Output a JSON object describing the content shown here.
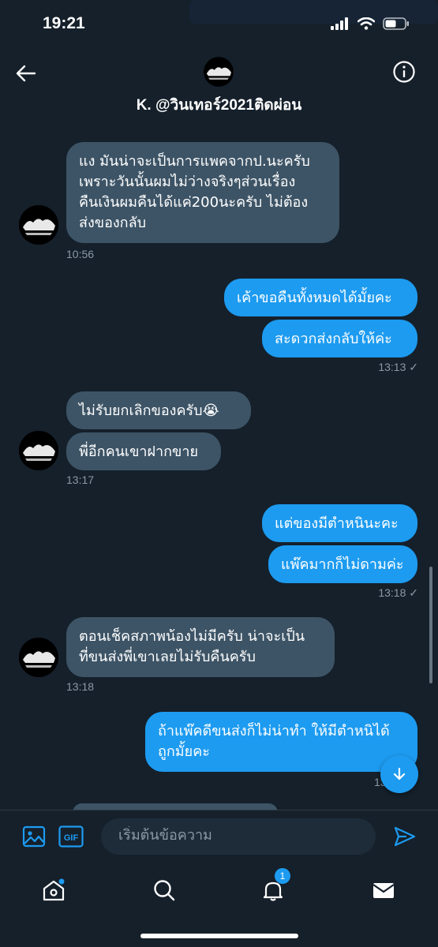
{
  "status": {
    "time": "19:21"
  },
  "header": {
    "title": "K. @วินเทอร์2021ติดผ่อน"
  },
  "messages": {
    "m1": {
      "text": "แง มันน่าจะเป็นการแพคจากป.นะครับ\nเพราะวันนั้นผมไม่ว่างจริงๆส่วนเรื่อง\nคืนเงินผมคืนได้แค่200นะครับ ไม่ต้อง\nส่งของกลับ",
      "time": "10:56"
    },
    "m2": {
      "text": "เค้าขอคืนทั้งหมดได้มั้ยคะ"
    },
    "m3": {
      "text": "สะดวกส่งกลับให้ค่ะ",
      "time": "13:13"
    },
    "m4": {
      "text": "ไม่รับยกเลิกของครับ😭"
    },
    "m5": {
      "text": "พี่อีกคนเขาฝากขาย",
      "time": "13:17"
    },
    "m6": {
      "text": "แต่ของมีตำหนินะคะ"
    },
    "m7": {
      "text": "แพ๊คมากก็ไม่ดามค่ะ",
      "time": "13:18"
    },
    "m8": {
      "text": "ตอนเช็คสภาพน้องไม่มีครับ น่าจะเป็น\nที่ขนส่งพี่เขาเลยไม่รับคืนครับ",
      "time": "13:18"
    },
    "m9": {
      "text": "ถ้าแพ๊คดีขนส่งก็ไม่น่าทำ ให้มีตำหนิได้\nถูกมั้ยคะ",
      "time": "13"
    }
  },
  "composer": {
    "placeholder": "เริ่มต้นข้อความ"
  },
  "tabs": {
    "notification_badge": "1"
  },
  "colors": {
    "background": "#15202b",
    "incoming_bubble": "#3d5466",
    "outgoing_bubble": "#1d9bf0"
  },
  "icons": {
    "back": "arrow-left-icon",
    "info": "info-icon",
    "image": "image-icon",
    "gif": "gif-icon",
    "send": "send-icon",
    "home": "home-icon",
    "search": "search-icon",
    "bell": "bell-icon",
    "mail": "mail-icon",
    "scroll_down": "arrow-down-icon"
  }
}
